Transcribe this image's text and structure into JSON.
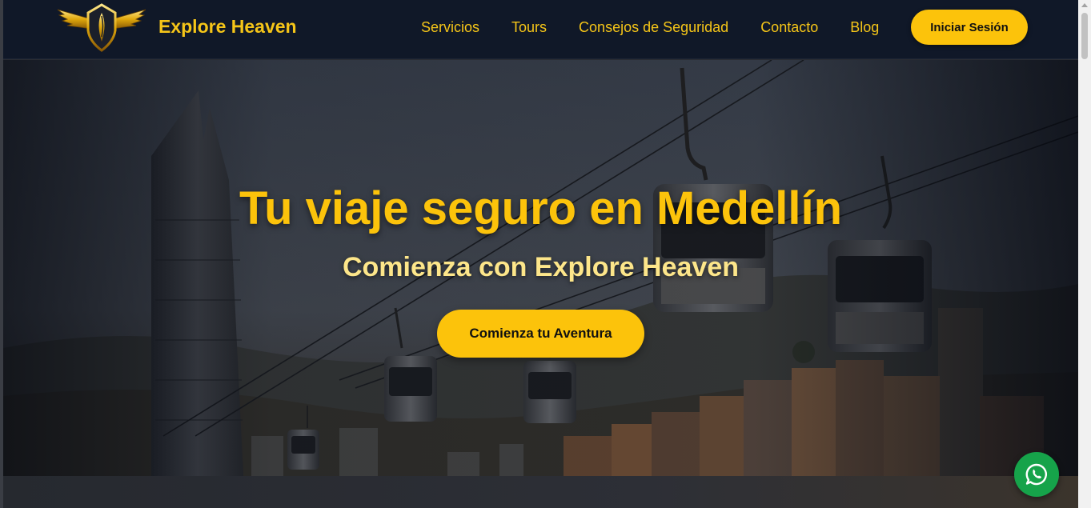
{
  "brand": {
    "name": "Explore Heaven",
    "logo_icon": "winged-shield-logo"
  },
  "nav": {
    "links": [
      {
        "label": "Servicios"
      },
      {
        "label": "Tours"
      },
      {
        "label": "Consejos de Seguridad"
      },
      {
        "label": "Contacto"
      },
      {
        "label": "Blog"
      }
    ],
    "login_label": "Iniciar Sesión"
  },
  "hero": {
    "title": "Tu viaje seguro en Medellín",
    "subtitle": "Comienza con Explore Heaven",
    "cta_label": "Comienza tu Aventura"
  },
  "floating": {
    "icon": "whatsapp-icon"
  },
  "colors": {
    "navbar_bg": "#101828",
    "accent": "#fcc30b",
    "subtitle": "#fde68a",
    "whatsapp": "#16a34a"
  }
}
